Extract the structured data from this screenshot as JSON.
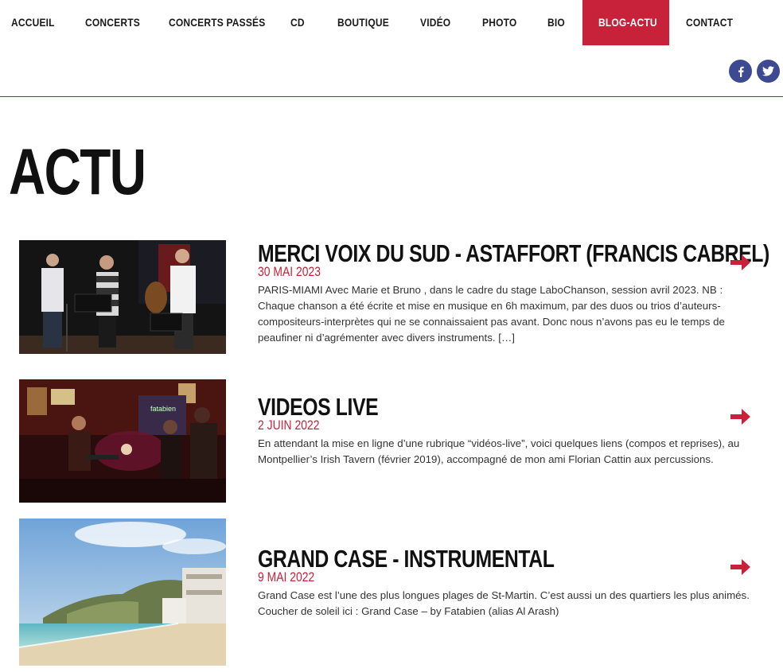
{
  "nav": {
    "items": [
      {
        "label": "ACCUEIL"
      },
      {
        "label": "CONCERTS"
      },
      {
        "label": "CONCERTS PASSÉS"
      },
      {
        "label": "CD"
      },
      {
        "label": "BOUTIQUE"
      },
      {
        "label": "VIDÉO"
      },
      {
        "label": "PHOTO"
      },
      {
        "label": "BIO"
      },
      {
        "label": "BLOG-ACTU"
      },
      {
        "label": "CONTACT"
      }
    ],
    "active": "BLOG-ACTU"
  },
  "social": {
    "icons": [
      "facebook-icon",
      "twitter-icon"
    ],
    "color": "#3d4a91"
  },
  "page": {
    "title": "ACTU"
  },
  "accent": "#c8213a",
  "posts": [
    {
      "title": "MERCI VOIX DU SUD - ASTAFFORT (FRANCIS CABREL)",
      "date": "30 MAI 2023",
      "excerpt": "PARIS-MIAMI Avec Marie et Bruno , dans le cadre du stage LaboChanson, session avril 2023. NB : Chaque chanson a été écrite et mise en musique en 6h maximum, par des duos ou trios d’auteurs-compositeurs-interprètes qui ne se connaissaient pas avant. Donc nous n’avons pas eu le temps de peaufiner ni d’agrémenter avec divers instruments. […]"
    },
    {
      "title": "VIDEOS LIVE",
      "date": "2 JUIN 2022",
      "excerpt": "En attendant la mise en ligne d’une rubrique “vidéos-live”, voici quelques liens (compos et reprises), au Montpellier’s Irish Tavern (février 2019), accompagné de mon ami Florian Cattin aux percussions."
    },
    {
      "title": "GRAND CASE - INSTRUMENTAL",
      "date": "9 MAI 2022",
      "excerpt": "Grand Case est l’une des plus longues plages de St-Martin. C’est aussi un des quartiers les plus animés. Coucher de soleil ici : Grand Case – by Fatabien (alias Al Arash)"
    }
  ]
}
